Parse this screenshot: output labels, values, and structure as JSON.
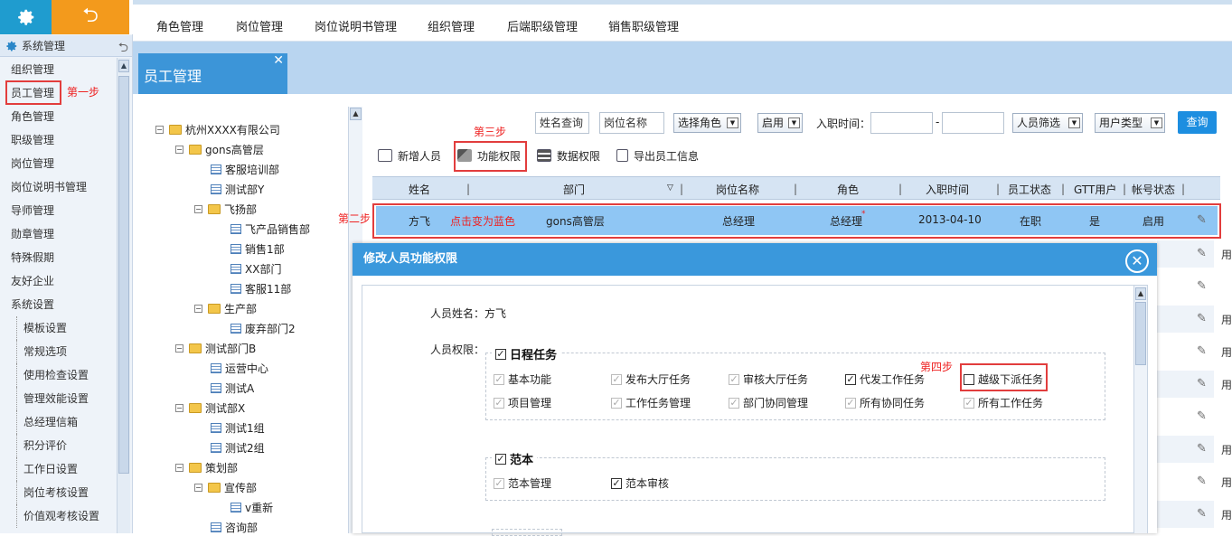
{
  "top_tabs": [
    "角色管理",
    "岗位管理",
    "岗位说明书管理",
    "组织管理",
    "后端职级管理",
    "销售职级管理"
  ],
  "sidebar": {
    "section": "系统管理",
    "items": [
      "组织管理",
      "员工管理",
      "角色管理",
      "职级管理",
      "岗位管理",
      "岗位说明书管理",
      "导师管理",
      "勋章管理",
      "特殊假期",
      "友好企业",
      "系统设置"
    ],
    "sub_items": [
      "模板设置",
      "常规选项",
      "使用检查设置",
      "管理效能设置",
      "总经理信箱",
      "积分评价",
      "工作日设置",
      "岗位考核设置",
      "价值观考核设置"
    ]
  },
  "annotations": {
    "step1": "第一步",
    "step2": "第二步",
    "step3": "第三步",
    "step4": "第四步",
    "row_note": "点击变为蓝色"
  },
  "page_title": "员工管理",
  "tree": [
    {
      "label": "杭州XXXX有限公司"
    },
    {
      "label": "gons高管层"
    },
    {
      "label": "客服培训部"
    },
    {
      "label": "测试部Y"
    },
    {
      "label": "飞扬部"
    },
    {
      "label": "飞产品销售部"
    },
    {
      "label": "销售1部"
    },
    {
      "label": "XX部门"
    },
    {
      "label": "客服11部"
    },
    {
      "label": "生产部"
    },
    {
      "label": "废弃部门2"
    },
    {
      "label": "测试部门B"
    },
    {
      "label": "运营中心"
    },
    {
      "label": "测试A"
    },
    {
      "label": "测试部X"
    },
    {
      "label": "测试1组"
    },
    {
      "label": "测试2组"
    },
    {
      "label": "策划部"
    },
    {
      "label": "宣传部"
    },
    {
      "label": "v重新"
    },
    {
      "label": "咨询部"
    }
  ],
  "filters": {
    "name_query": "姓名查询",
    "position_name": "岗位名称",
    "role_select": "选择角色",
    "enable_select": "启用",
    "hire_time_label": "入职时间：",
    "dash": "-",
    "staff_filter": "人员筛选",
    "user_type": "用户类型",
    "query_button": "查询"
  },
  "actions": [
    "新增人员",
    "功能权限",
    "数据权限",
    "导出员工信息"
  ],
  "table": {
    "headers": [
      "姓名",
      "部门",
      "岗位名称",
      "角色",
      "入职时间",
      "员工状态",
      "GTT用户",
      "帐号状态"
    ],
    "row": {
      "name": "方飞",
      "dept": "gons高管层",
      "position": "总经理",
      "role": "总经理",
      "hire_date": "2013-04-10",
      "status": "在职",
      "gtt": "是",
      "account": "启用"
    },
    "stub": "用"
  },
  "modal": {
    "title": "修改人员功能权限",
    "person_label": "人员姓名：方飞",
    "perm_label": "人员权限：",
    "groups": [
      {
        "title": "日程任务",
        "items": [
          "基本功能",
          "发布大厅任务",
          "审核大厅任务",
          "代发工作任务",
          "越级下派任务",
          "项目管理",
          "工作任务管理",
          "部门协同管理",
          "所有协同任务",
          "所有工作任务"
        ]
      },
      {
        "title": "范本",
        "items": [
          "范本管理",
          "范本审核"
        ]
      }
    ]
  }
}
